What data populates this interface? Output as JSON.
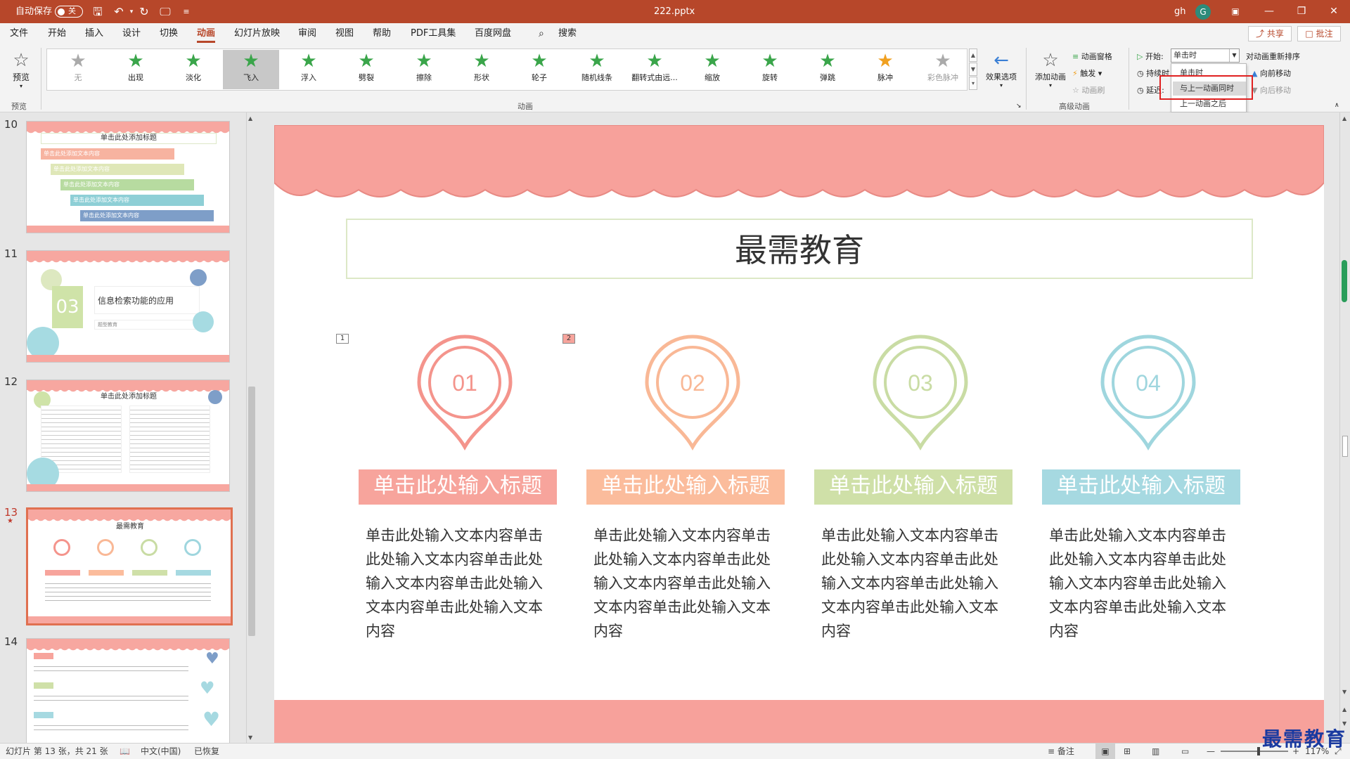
{
  "titlebar": {
    "autosave_label": "自动保存",
    "autosave_state": "关",
    "filename": "222.pptx",
    "user_initials": "gh",
    "avatar_letter": "G"
  },
  "menu": {
    "items": [
      "文件",
      "开始",
      "插入",
      "设计",
      "切换",
      "动画",
      "幻灯片放映",
      "审阅",
      "视图",
      "帮助",
      "PDF工具集",
      "百度网盘"
    ],
    "active": "动画",
    "search": "搜索",
    "share": "共享",
    "comment": "批注"
  },
  "ribbon": {
    "preview_label": "预览",
    "preview_group": "预览",
    "animations": [
      "无",
      "出现",
      "淡化",
      "飞入",
      "浮入",
      "劈裂",
      "擦除",
      "形状",
      "轮子",
      "随机线条",
      "翻转式由远...",
      "缩放",
      "旋转",
      "弹跳",
      "脉冲",
      "彩色脉冲"
    ],
    "selected_animation": "飞入",
    "effect_options": "效果选项",
    "animation_group": "动画",
    "add_animation": "添加动画",
    "animation_pane": "动画窗格",
    "trigger": "触发",
    "animation_painter": "动画刷",
    "advanced_group": "高级动画",
    "start_label": "开始:",
    "start_value": "单击时",
    "duration_label": "持续时",
    "delay_label": "延迟:",
    "reorder_title": "对动画重新排序",
    "move_earlier": "向前移动",
    "move_later": "向后移动",
    "dropdown_options": [
      "单击时",
      "与上一动画同时",
      "上一动画之后"
    ],
    "dropdown_highlight": "与上一动画同时"
  },
  "thumbnails": [
    {
      "num": "10",
      "title": "单击此处添加标题",
      "items": [
        "单击此处添加文本内容",
        "单击此处添加文本内容",
        "单击此处添加文本内容",
        "单击此处添加文本内容",
        "单击此处添加文本内容"
      ]
    },
    {
      "num": "11",
      "badge": "03",
      "title": "信息检索功能的应用",
      "sub": "题型教育"
    },
    {
      "num": "12",
      "title": "单击此处添加标题"
    },
    {
      "num": "13",
      "title": "最需教育",
      "star": "★"
    },
    {
      "num": "14"
    }
  ],
  "slide": {
    "title": "最需教育",
    "tags": [
      "1",
      "2"
    ],
    "pins": [
      {
        "num": "01",
        "color": "#f4948c",
        "caption": "单击此处输入标题",
        "caption_bg": "#f7a49c"
      },
      {
        "num": "02",
        "color": "#f9b896",
        "caption": "单击此处输入标题",
        "caption_bg": "#fbbc9c"
      },
      {
        "num": "03",
        "color": "#c9dca4",
        "caption": "单击此处输入标题",
        "caption_bg": "#cfe0a8"
      },
      {
        "num": "04",
        "color": "#9fd6de",
        "caption": "单击此处输入标题",
        "caption_bg": "#a6d9e1"
      }
    ],
    "body": "单击此处输入文本内容单击此处输入文本内容单击此处输入文本内容单击此处输入文本内容单击此处输入文本内容"
  },
  "status": {
    "slide_info": "幻灯片 第 13 张，共 21 张",
    "language": "中文(中国)",
    "recovered": "已恢复",
    "notes": "备注",
    "zoom": "117%"
  },
  "watermark": "最需教育"
}
